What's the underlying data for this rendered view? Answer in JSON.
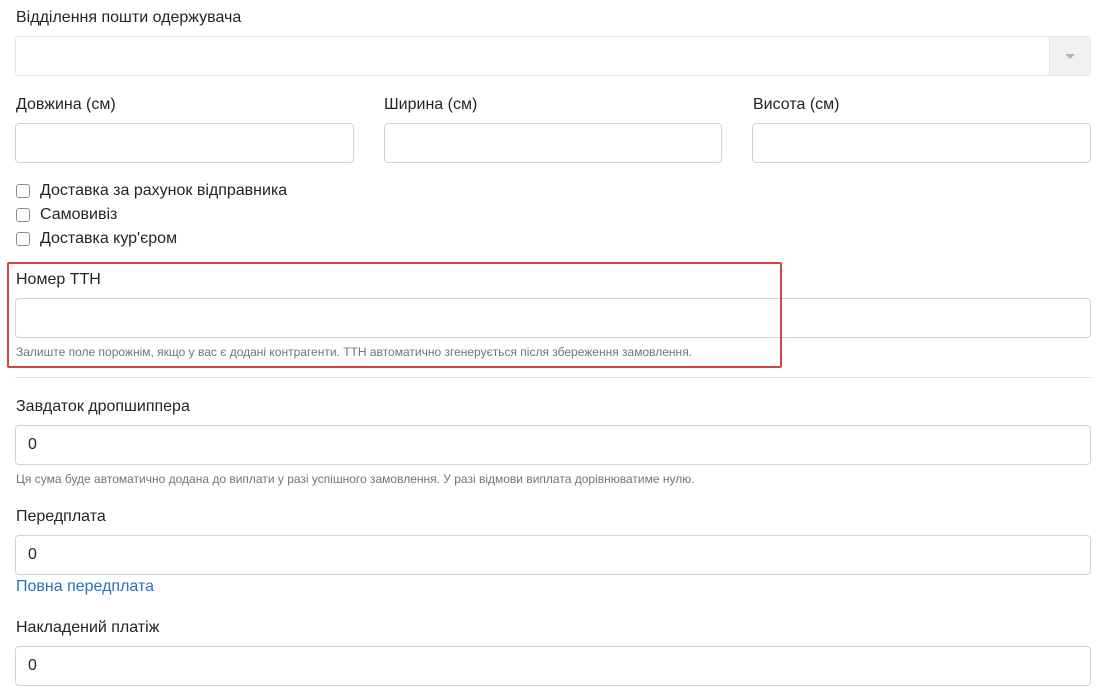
{
  "branch": {
    "label": "Відділення пошти одержувача",
    "value": ""
  },
  "dimensions": {
    "length_label": "Довжина (см)",
    "width_label": "Ширина (см)",
    "height_label": "Висота (см)",
    "length_value": "",
    "width_value": "",
    "height_value": ""
  },
  "options": [
    {
      "label": "Доставка за рахунок відправника",
      "checked": false
    },
    {
      "label": "Самовивіз",
      "checked": false
    },
    {
      "label": "Доставка кур'єром",
      "checked": false
    }
  ],
  "ttn": {
    "label": "Номер ТТН",
    "value": "",
    "help": "Залиште поле порожнім, якщо у вас є додані контрагенти. ТТН автоматично згенерується після збереження замовлення.",
    "highlight_color": "#d64545"
  },
  "deposit": {
    "label": "Завдаток дропшиппера",
    "value": "0",
    "help": "Ця сума буде автоматично додана до виплати у разі успішного замовлення. У разі відмови виплата дорівнюватиме нулю."
  },
  "prepayment": {
    "label": "Передплата",
    "value": "0",
    "full_link": "Повна передплата"
  },
  "cod": {
    "label": "Накладений платіж",
    "value": "0"
  },
  "colors": {
    "link": "#2a6fbf",
    "border": "#ced4da",
    "help_text": "#6c757d"
  }
}
